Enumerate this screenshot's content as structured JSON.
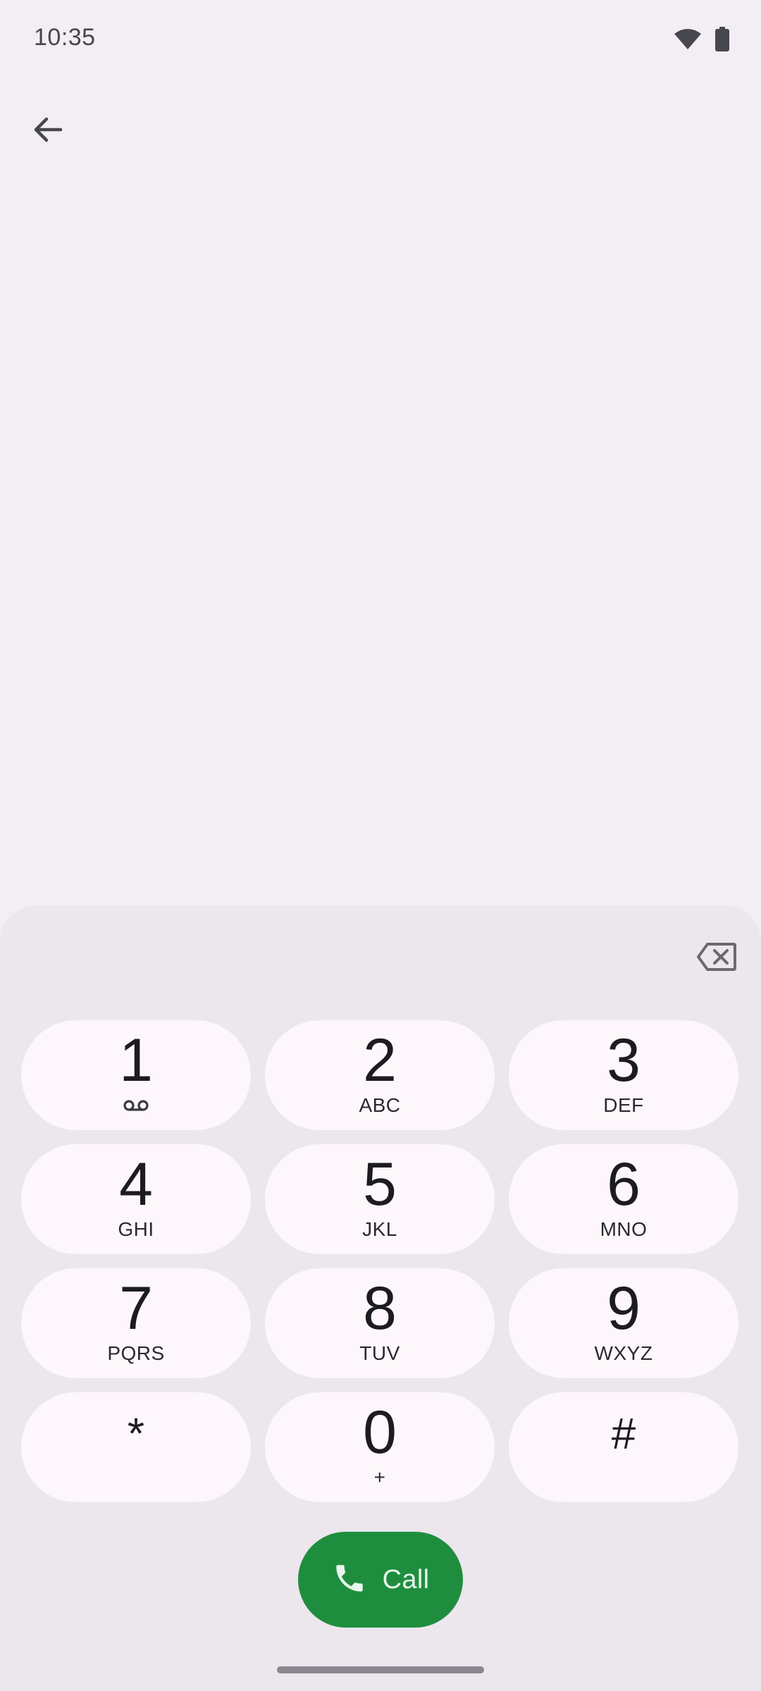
{
  "status_bar": {
    "time": "10:35",
    "icons": [
      "wifi-icon",
      "battery-icon"
    ]
  },
  "top_bar": {
    "back_icon": "arrow-back-icon"
  },
  "dialpad": {
    "digits_value": "",
    "backspace_icon": "backspace-icon",
    "keys": [
      {
        "digit": "1",
        "letters": "",
        "sub_icon": "voicemail-icon"
      },
      {
        "digit": "2",
        "letters": "ABC"
      },
      {
        "digit": "3",
        "letters": "DEF"
      },
      {
        "digit": "4",
        "letters": "GHI"
      },
      {
        "digit": "5",
        "letters": "JKL"
      },
      {
        "digit": "6",
        "letters": "MNO"
      },
      {
        "digit": "7",
        "letters": "PQRS"
      },
      {
        "digit": "8",
        "letters": "TUV"
      },
      {
        "digit": "9",
        "letters": "WXYZ"
      },
      {
        "digit": "*",
        "letters": ""
      },
      {
        "digit": "0",
        "letters": "+"
      },
      {
        "digit": "#",
        "letters": ""
      }
    ],
    "call_label": "Call",
    "call_icon": "phone-icon"
  },
  "colors": {
    "background": "#f2eef3",
    "sheet": "#ece6ed",
    "key": "#fdf7fc",
    "call_button": "#1e8e3e"
  }
}
